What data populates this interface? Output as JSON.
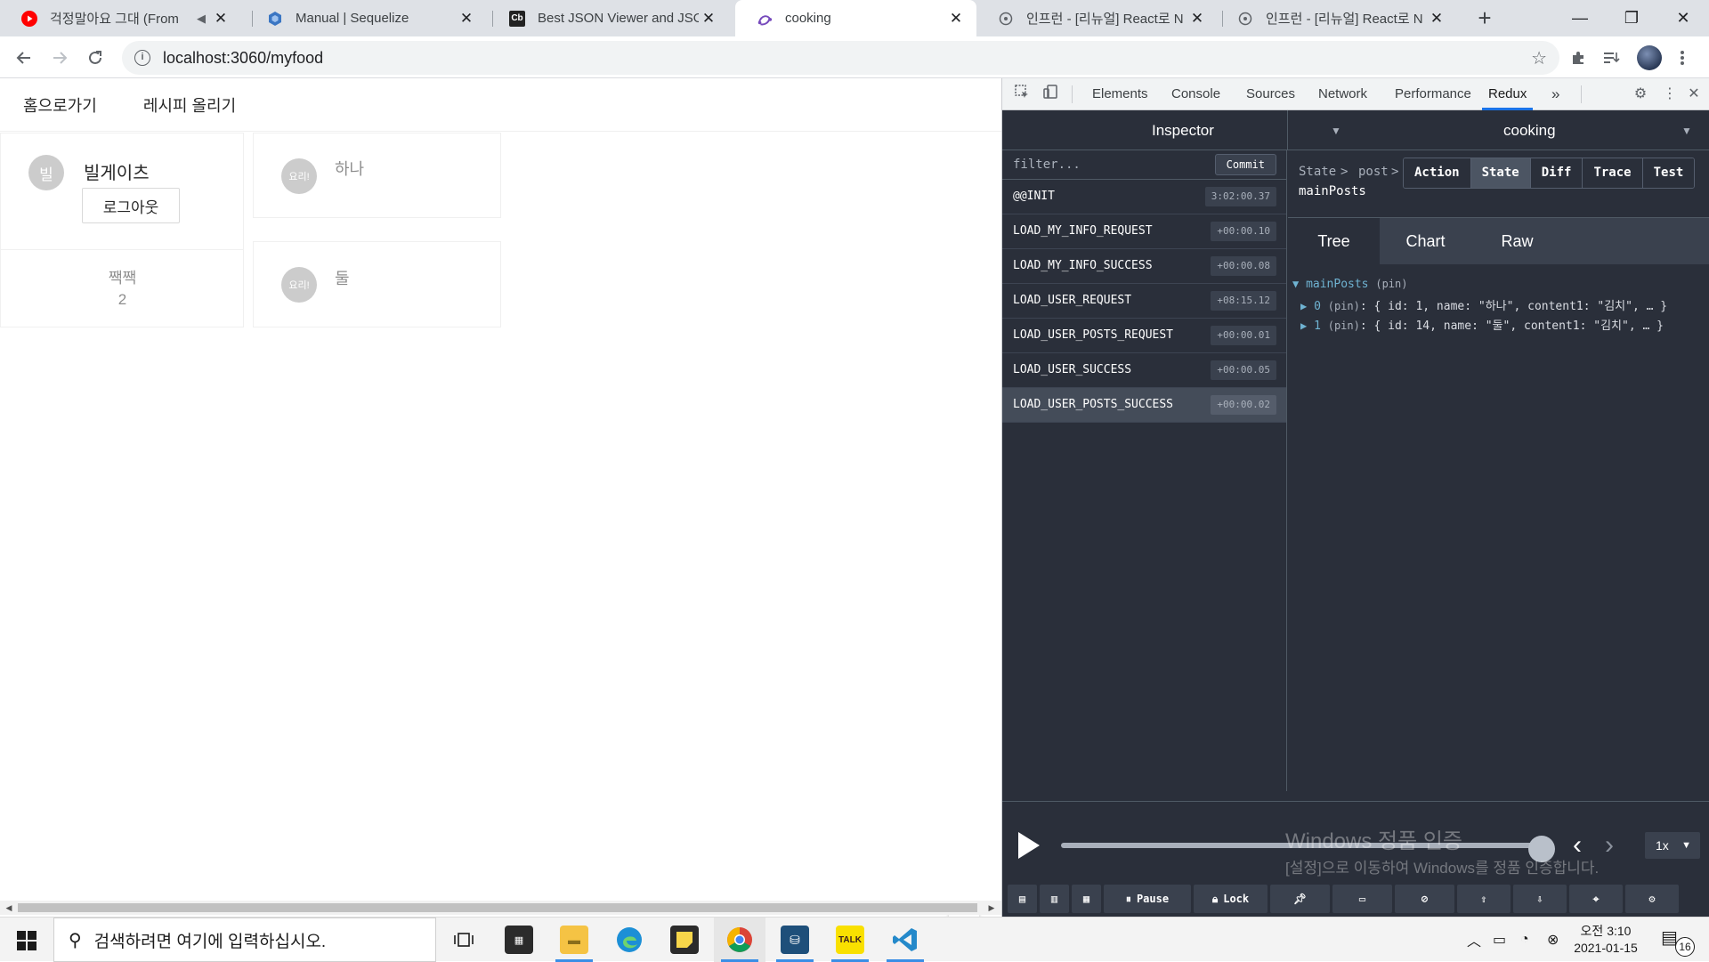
{
  "browser": {
    "tabs": [
      {
        "title": "걱정말아요 그대 (From ",
        "icon": "youtube-icon",
        "has_mute": true
      },
      {
        "title": "Manual | Sequelize",
        "icon": "sequelize-icon"
      },
      {
        "title": "Best JSON Viewer and JSON",
        "icon": "codebeautify-icon",
        "favicon_text": "Cb"
      },
      {
        "title": "cooking",
        "icon": "redux-icon"
      },
      {
        "title": "인프런 - [리뉴얼] React로 N",
        "icon": "inflearn-icon"
      },
      {
        "title": "인프런 - [리뉴얼] React로 N",
        "icon": "inflearn-icon"
      }
    ],
    "new_tab": "+",
    "window_controls": {
      "minimize": "—",
      "restore": "❐",
      "close": "✕"
    },
    "url": "localhost:3060/myfood"
  },
  "page": {
    "nav": {
      "home": "홈으로가기",
      "upload": "레시피 올리기"
    },
    "profile": {
      "avatar_letter": "빌",
      "name": "빌게이츠",
      "logout_label": "로그아웃",
      "stat_label": "짹짹",
      "stat_value": "2"
    },
    "posts": [
      {
        "avatar_text": "요리!",
        "title": "하나"
      },
      {
        "avatar_text": "요리!",
        "title": "둘"
      }
    ]
  },
  "devtools": {
    "tabs": [
      "Elements",
      "Console",
      "Sources",
      "Network",
      "Performance",
      "Redux"
    ],
    "active_tab": "Redux",
    "more": "»",
    "redux": {
      "monitor_select": "Inspector",
      "instance_select": "cooking",
      "filter_placeholder": "filter...",
      "commit_label": "Commit",
      "actions": [
        {
          "name": "@@INIT",
          "time": "3:02:00.37"
        },
        {
          "name": "LOAD_MY_INFO_REQUEST",
          "time": "+00:00.10"
        },
        {
          "name": "LOAD_MY_INFO_SUCCESS",
          "time": "+00:00.08"
        },
        {
          "name": "LOAD_USER_REQUEST",
          "time": "+08:15.12"
        },
        {
          "name": "LOAD_USER_POSTS_REQUEST",
          "time": "+00:00.01"
        },
        {
          "name": "LOAD_USER_SUCCESS",
          "time": "+00:00.05"
        },
        {
          "name": "LOAD_USER_POSTS_SUCCESS",
          "time": "+00:00.02"
        }
      ],
      "selected_action_index": 6,
      "breadcrumb": {
        "root": "State",
        "sep": ">",
        "child": "post",
        "sep2": ">",
        "leaf": "mainPosts"
      },
      "panel_buttons": [
        "Action",
        "State",
        "Diff",
        "Trace",
        "Test"
      ],
      "active_panel": "State",
      "view_tabs": [
        "Tree",
        "Chart",
        "Raw"
      ],
      "active_view": "Tree",
      "tree": {
        "root_key": "mainPosts",
        "root_meta": "(pin)",
        "items": [
          {
            "key": "0",
            "meta": "(pin)",
            "preview": ": { id: 1, name: \"하나\", content1: \"김치\", … }"
          },
          {
            "key": "1",
            "meta": "(pin)",
            "preview": ": { id: 14, name: \"둘\", content1: \"김치\", … }"
          }
        ]
      },
      "slider_position": 1.0,
      "speed": "1x",
      "bottom_buttons": [
        "",
        "",
        "",
        "Pause",
        "Lock",
        "",
        "",
        "",
        "",
        "",
        "",
        ""
      ],
      "watermark_line1": "Windows 정품 인증",
      "watermark_line2": "[설정]으로 이동하여 Windows를 정품 인증합니다."
    }
  },
  "taskbar": {
    "search_placeholder": "검색하려면 여기에 입력하십시오.",
    "apps": [
      "task-view",
      "store",
      "file-explorer",
      "edge",
      "sticky-notes",
      "chrome",
      "mysql-workbench",
      "kakaotalk",
      "vscode"
    ],
    "running": [
      "file-explorer",
      "chrome",
      "mysql-workbench",
      "kakaotalk",
      "vscode"
    ],
    "clock_time": "오전 3:10",
    "clock_date": "2021-01-15",
    "notification_count": "16"
  }
}
